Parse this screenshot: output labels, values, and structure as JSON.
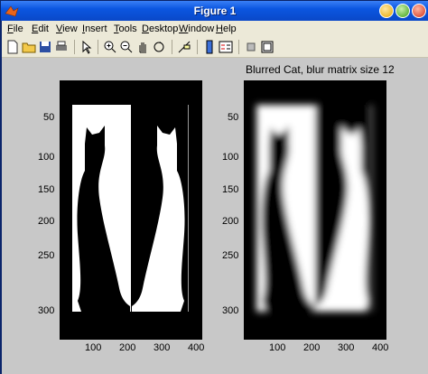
{
  "window": {
    "title": "Figure 1"
  },
  "menu": [
    "File",
    "Edit",
    "View",
    "Insert",
    "Tools",
    "Desktop",
    "Window",
    "Help"
  ],
  "toolbar": [
    "new-figure",
    "open-file",
    "save",
    "print",
    "edit-plot",
    "zoom-in",
    "zoom-out",
    "pan",
    "rotate-3d",
    "data-cursor",
    "colorbar",
    "legend",
    "hide-plot-tools",
    "show-plot-tools"
  ],
  "left_axes": {
    "title": "",
    "yticks": [
      "50",
      "100",
      "150",
      "200",
      "250",
      "300"
    ],
    "xticks": [
      "100",
      "200",
      "300",
      "400"
    ]
  },
  "right_axes": {
    "title": "Blurred Cat, blur matrix size 12",
    "yticks": [
      "50",
      "100",
      "150",
      "200",
      "250",
      "300"
    ],
    "xticks": [
      "100",
      "200",
      "300",
      "400"
    ]
  }
}
